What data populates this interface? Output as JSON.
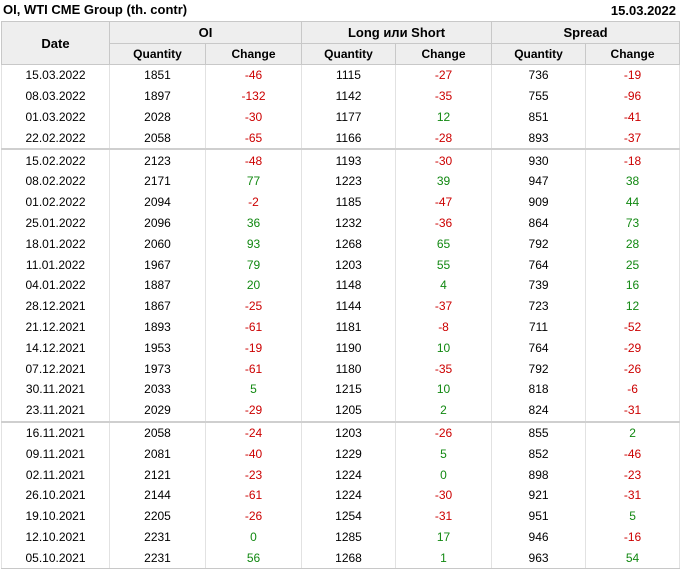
{
  "header": {
    "title": "OI, WTI CME Group (th. contr)",
    "date": "15.03.2022"
  },
  "columns": {
    "date": "Date",
    "groups": [
      "OI",
      "Long или Short",
      "Spread"
    ],
    "quantity": "Quantity",
    "change": "Change"
  },
  "colors": {
    "negative": "#cc0000",
    "positive": "#118811",
    "header_bg": "#eeeeee"
  },
  "rows": [
    {
      "date": "15.03.2022",
      "oi_q": "1851",
      "oi_c": "-46",
      "ls_q": "1115",
      "ls_c": "-27",
      "sp_q": "736",
      "sp_c": "-19",
      "sep": false
    },
    {
      "date": "08.03.2022",
      "oi_q": "1897",
      "oi_c": "-132",
      "ls_q": "1142",
      "ls_c": "-35",
      "sp_q": "755",
      "sp_c": "-96",
      "sep": false
    },
    {
      "date": "01.03.2022",
      "oi_q": "2028",
      "oi_c": "-30",
      "ls_q": "1177",
      "ls_c": "12",
      "sp_q": "851",
      "sp_c": "-41",
      "sep": false
    },
    {
      "date": "22.02.2022",
      "oi_q": "2058",
      "oi_c": "-65",
      "ls_q": "1166",
      "ls_c": "-28",
      "sp_q": "893",
      "sp_c": "-37",
      "sep": false
    },
    {
      "date": "15.02.2022",
      "oi_q": "2123",
      "oi_c": "-48",
      "ls_q": "1193",
      "ls_c": "-30",
      "sp_q": "930",
      "sp_c": "-18",
      "sep": true
    },
    {
      "date": "08.02.2022",
      "oi_q": "2171",
      "oi_c": "77",
      "ls_q": "1223",
      "ls_c": "39",
      "sp_q": "947",
      "sp_c": "38",
      "sep": false
    },
    {
      "date": "01.02.2022",
      "oi_q": "2094",
      "oi_c": "-2",
      "ls_q": "1185",
      "ls_c": "-47",
      "sp_q": "909",
      "sp_c": "44",
      "sep": false
    },
    {
      "date": "25.01.2022",
      "oi_q": "2096",
      "oi_c": "36",
      "ls_q": "1232",
      "ls_c": "-36",
      "sp_q": "864",
      "sp_c": "73",
      "sep": false
    },
    {
      "date": "18.01.2022",
      "oi_q": "2060",
      "oi_c": "93",
      "ls_q": "1268",
      "ls_c": "65",
      "sp_q": "792",
      "sp_c": "28",
      "sep": false
    },
    {
      "date": "11.01.2022",
      "oi_q": "1967",
      "oi_c": "79",
      "ls_q": "1203",
      "ls_c": "55",
      "sp_q": "764",
      "sp_c": "25",
      "sep": false
    },
    {
      "date": "04.01.2022",
      "oi_q": "1887",
      "oi_c": "20",
      "ls_q": "1148",
      "ls_c": "4",
      "sp_q": "739",
      "sp_c": "16",
      "sep": false
    },
    {
      "date": "28.12.2021",
      "oi_q": "1867",
      "oi_c": "-25",
      "ls_q": "1144",
      "ls_c": "-37",
      "sp_q": "723",
      "sp_c": "12",
      "sep": false
    },
    {
      "date": "21.12.2021",
      "oi_q": "1893",
      "oi_c": "-61",
      "ls_q": "1181",
      "ls_c": "-8",
      "sp_q": "711",
      "sp_c": "-52",
      "sep": false
    },
    {
      "date": "14.12.2021",
      "oi_q": "1953",
      "oi_c": "-19",
      "ls_q": "1190",
      "ls_c": "10",
      "sp_q": "764",
      "sp_c": "-29",
      "sep": false
    },
    {
      "date": "07.12.2021",
      "oi_q": "1973",
      "oi_c": "-61",
      "ls_q": "1180",
      "ls_c": "-35",
      "sp_q": "792",
      "sp_c": "-26",
      "sep": false
    },
    {
      "date": "30.11.2021",
      "oi_q": "2033",
      "oi_c": "5",
      "ls_q": "1215",
      "ls_c": "10",
      "sp_q": "818",
      "sp_c": "-6",
      "sep": false
    },
    {
      "date": "23.11.2021",
      "oi_q": "2029",
      "oi_c": "-29",
      "ls_q": "1205",
      "ls_c": "2",
      "sp_q": "824",
      "sp_c": "-31",
      "sep": false
    },
    {
      "date": "16.11.2021",
      "oi_q": "2058",
      "oi_c": "-24",
      "ls_q": "1203",
      "ls_c": "-26",
      "sp_q": "855",
      "sp_c": "2",
      "sep": true
    },
    {
      "date": "09.11.2021",
      "oi_q": "2081",
      "oi_c": "-40",
      "ls_q": "1229",
      "ls_c": "5",
      "sp_q": "852",
      "sp_c": "-46",
      "sep": false
    },
    {
      "date": "02.11.2021",
      "oi_q": "2121",
      "oi_c": "-23",
      "ls_q": "1224",
      "ls_c": "0",
      "sp_q": "898",
      "sp_c": "-23",
      "sep": false
    },
    {
      "date": "26.10.2021",
      "oi_q": "2144",
      "oi_c": "-61",
      "ls_q": "1224",
      "ls_c": "-30",
      "sp_q": "921",
      "sp_c": "-31",
      "sep": false
    },
    {
      "date": "19.10.2021",
      "oi_q": "2205",
      "oi_c": "-26",
      "ls_q": "1254",
      "ls_c": "-31",
      "sp_q": "951",
      "sp_c": "5",
      "sep": false
    },
    {
      "date": "12.10.2021",
      "oi_q": "2231",
      "oi_c": "0",
      "ls_q": "1285",
      "ls_c": "17",
      "sp_q": "946",
      "sp_c": "-16",
      "sep": false
    },
    {
      "date": "05.10.2021",
      "oi_q": "2231",
      "oi_c": "56",
      "ls_q": "1268",
      "ls_c": "1",
      "sp_q": "963",
      "sp_c": "54",
      "sep": false
    }
  ]
}
